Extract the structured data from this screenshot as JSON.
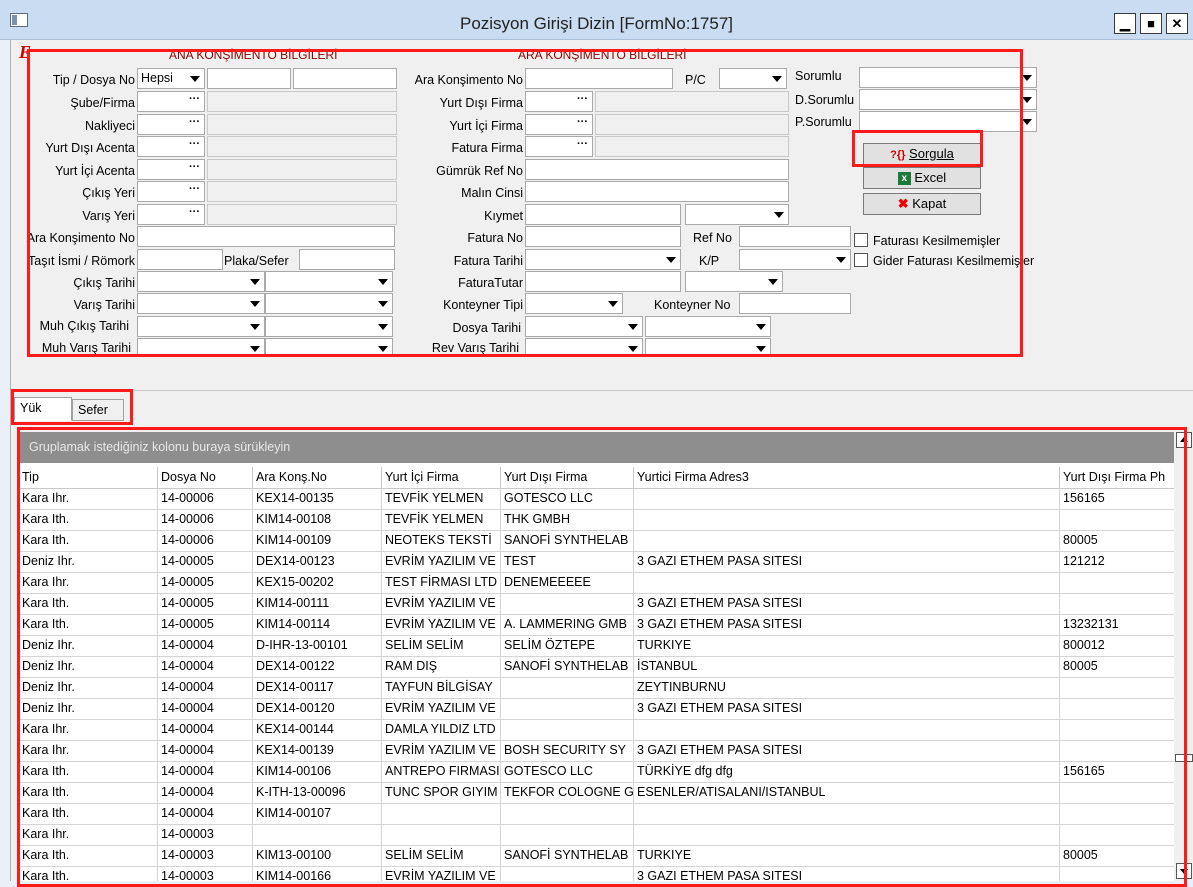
{
  "window": {
    "title": "Pozisyon Girişi Dizin [FormNo:1757]",
    "buttons": {
      "minimize": "▁",
      "maximize": "■",
      "close": "✕"
    }
  },
  "form": {
    "logo": "E",
    "left_section_title": "ANA KONŞİMENTO  BİLGİLERİ",
    "middle_section_title": "ARA KONŞİMENTO  BİLGİLERİ",
    "labels": {
      "tip_dosya_no": "Tip / Dosya No",
      "sube_firma": "Şube/Firma",
      "nakliyeci": "Nakliyeci",
      "yurt_disi_acenta": "Yurt Dışı Acenta",
      "yurt_ici_acenta": "Yurt İçi Acenta",
      "cikis_yeri": "Çıkış Yeri",
      "varis_yeri": "Varış Yeri",
      "ara_konsimento_no": "Ara Konşimento No",
      "tasit_ismi": "Taşıt İsmi / Römork",
      "plaka_sefer": "Plaka/Sefer",
      "cikis_tarihi": "Çıkış Tarihi",
      "varis_tarihi": "Varış Tarihi",
      "muh_cikis_tarihi": "Muh Çıkış Tarihi",
      "muh_varis_tarihi": "Muh Varış Tarihi",
      "ara_konsimento_no2": "Ara Konşimento No",
      "pc": "P/C",
      "yurt_disi_firma": "Yurt Dışı Firma",
      "yurt_ici_firma": "Yurt İçi Firma",
      "fatura_firma": "Fatura Firma",
      "gumruk_ref_no": "Gümrük Ref No",
      "malin_cinsi": "Malın Cinsi",
      "kiymet": "Kıymet",
      "fatura_no": "Fatura No",
      "ref_no": "Ref No",
      "fatura_tarihi": "Fatura Tarihi",
      "kp": "K/P",
      "fatura_tutar": "FaturaTutar",
      "konteyner_tipi": "Konteyner Tipi",
      "konteyner_no": "Konteyner No",
      "dosya_tarihi": "Dosya Tarihi",
      "rev_varis_tarihi": "Rev Varış Tarihi",
      "sorumlu": "Sorumlu",
      "d_sorumlu": "D.Sorumlu",
      "p_sorumlu": "P.Sorumlu"
    },
    "tip_value": "Hepsi",
    "lookup_button": "···",
    "buttons": {
      "sorgula": "Sorgula",
      "sorgula_icon": "?{}",
      "excel": "Excel",
      "kapat": "Kapat"
    },
    "checkboxes": {
      "faturasi_kesilmemisler": "Faturası Kesilmemişler",
      "gider_faturasi_kesilmemisler": "Gider Faturası Kesilmemişler"
    }
  },
  "tabs": [
    {
      "label": "Yük",
      "active": true
    },
    {
      "label": "Sefer",
      "active": false
    }
  ],
  "grid": {
    "group_hint": "Gruplamak istediğiniz kolonu buraya sürükleyin",
    "columns": [
      "Tip",
      "Dosya No",
      "Ara Konş.No",
      "Yurt İçi Firma",
      "Yurt Dışı Firma",
      "Yurtici Firma Adres3",
      "Yurt Dışı Firma Ph"
    ],
    "rows": [
      [
        "Kara  Ihr.",
        "14-00006",
        "KEX14-00135",
        "TEVFİK YELMEN",
        "GOTESCO LLC",
        "",
        "156165"
      ],
      [
        "Kara  Ith.",
        "14-00006",
        "KIM14-00108",
        "TEVFİK YELMEN",
        "THK GMBH",
        "",
        ""
      ],
      [
        "Kara  Ith.",
        "14-00006",
        "KIM14-00109",
        "NEOTEKS TEKSTİ",
        "SANOFİ SYNTHELAB",
        "",
        "80005"
      ],
      [
        "Deniz Ihr.",
        "14-00005",
        "DEX14-00123",
        "EVRİM YAZILIM VE",
        "TEST",
        "3 GAZI ETHEM PASA SITESI",
        "121212"
      ],
      [
        "Kara  Ihr.",
        "14-00005",
        "KEX15-00202",
        "TEST FİRMASI LTD",
        "DENEMEEEEE",
        "",
        ""
      ],
      [
        "Kara  Ith.",
        "14-00005",
        "KIM14-00111",
        "EVRİM YAZILIM VE",
        "",
        "3 GAZI ETHEM PASA SITESI",
        ""
      ],
      [
        "Kara  Ith.",
        "14-00005",
        "KIM14-00114",
        "EVRİM YAZILIM VE",
        "A. LAMMERING GMB",
        "3 GAZI ETHEM PASA SITESI",
        "13232131"
      ],
      [
        "Deniz Ihr.",
        "14-00004",
        "D-IHR-13-00101",
        "SELİM SELİM",
        "SELİM ÖZTEPE",
        "TURKIYE",
        "800012"
      ],
      [
        "Deniz Ihr.",
        "14-00004",
        "DEX14-00122",
        "RAM DIŞ",
        "SANOFİ SYNTHELAB",
        "İSTANBUL",
        "80005"
      ],
      [
        "Deniz Ihr.",
        "14-00004",
        "DEX14-00117",
        "TAYFUN BİLGİSAY",
        "",
        "ZEYTINBURNU",
        ""
      ],
      [
        "Deniz Ihr.",
        "14-00004",
        "DEX14-00120",
        "EVRİM YAZILIM VE",
        "",
        "3 GAZI ETHEM PASA SITESI",
        ""
      ],
      [
        "Kara  Ihr.",
        "14-00004",
        "KEX14-00144",
        "DAMLA YILDIZ LTD",
        "",
        "",
        ""
      ],
      [
        "Kara  Ihr.",
        "14-00004",
        "KEX14-00139",
        "EVRİM YAZILIM VE",
        "BOSH SECURITY  SY",
        "3 GAZI ETHEM PASA SITESI",
        ""
      ],
      [
        "Kara  Ith.",
        "14-00004",
        "KIM14-00106",
        "ANTREPO FIRMASI",
        "GOTESCO LLC",
        "TÜRKİYE dfg dfg",
        "156165"
      ],
      [
        "Kara  Ith.",
        "14-00004",
        "K-ITH-13-00096",
        "TUNC SPOR GIYIM",
        "TEKFOR COLOGNE G",
        "ESENLER/ATISALANI/ISTANBUL",
        ""
      ],
      [
        "Kara  Ith.",
        "14-00004",
        "KIM14-00107",
        "",
        "",
        "",
        ""
      ],
      [
        "Kara  Ihr.",
        "14-00003",
        "",
        "",
        "",
        "",
        ""
      ],
      [
        "Kara  Ith.",
        "14-00003",
        "KIM13-00100",
        "SELİM SELİM",
        "SANOFİ SYNTHELAB",
        "TURKIYE",
        "80005"
      ],
      [
        "Kara  Ith.",
        "14-00003",
        "KIM14-00166",
        "EVRİM YAZILIM VE",
        "",
        "3 GAZI ETHEM PASA SITESI",
        ""
      ]
    ]
  },
  "colors": {
    "highlight": "#ff1a1a",
    "section_title": "#8b0000",
    "group_bar": "#8e8e8e"
  }
}
